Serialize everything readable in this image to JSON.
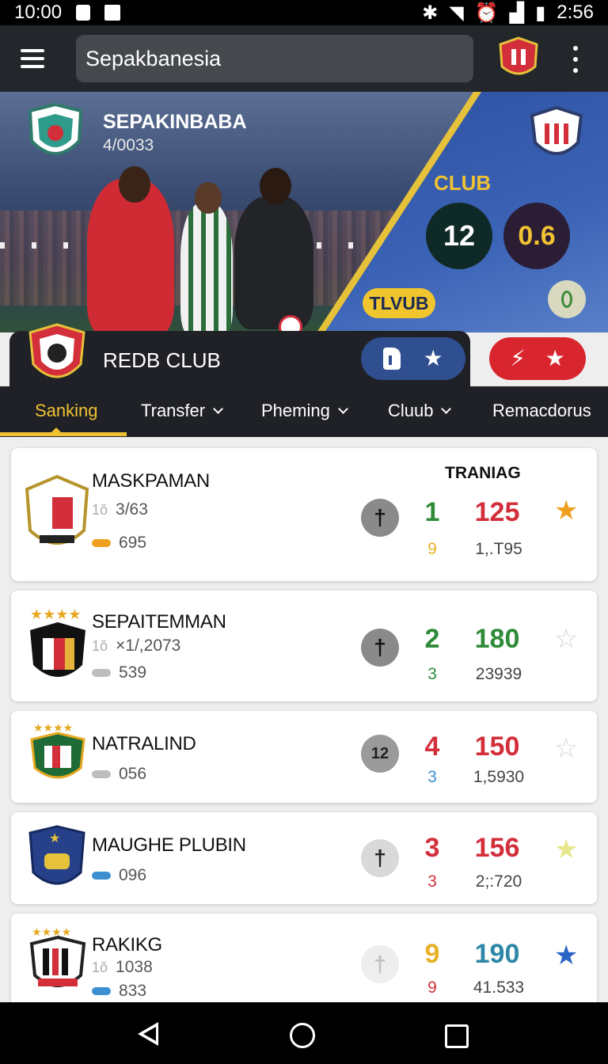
{
  "status_bar": {
    "time_left": "10:00",
    "time_right": "2:56"
  },
  "app_bar": {
    "search_value": "Sepakbanesia"
  },
  "hero": {
    "title": "SEPAKINBABA",
    "subtitle": "4/0033",
    "club_label": "CLUB",
    "score_home": "12",
    "score_away": "0.6",
    "badge": "TLVUB"
  },
  "club_bar": {
    "name": "REDB CLUB"
  },
  "tabs": [
    {
      "label": "Sanking",
      "active": true
    },
    {
      "label": "Transfer"
    },
    {
      "label": "Pheming"
    },
    {
      "label": "Cluub"
    },
    {
      "label": "Remacdorus"
    }
  ],
  "list": {
    "column_header": "TRANIAG",
    "rows": [
      {
        "name": "MASKPAMAN",
        "meta1": "3/63",
        "meta2": "695",
        "cross": "†",
        "rank": "1",
        "rank_color": "#2e8b3a",
        "rank_sub": "9",
        "rank_sub_color": "#e8b12a",
        "points": "125",
        "points_color": "#d22f3b",
        "pts_sub": "1,.T95",
        "star": "★",
        "star_color": "#f0a020"
      },
      {
        "name": "SEPAITEMMAN",
        "meta1": "×1/,2073",
        "meta2": "539",
        "cross": "†",
        "rank": "2",
        "rank_color": "#2e8b3a",
        "rank_sub": "3",
        "rank_sub_color": "#2e8b3a",
        "points": "180",
        "points_color": "#2e8b3a",
        "pts_sub": "23939",
        "star": "☆",
        "star_color": "#d6d6d6"
      },
      {
        "name": "NATRALIND",
        "meta1": "",
        "meta2": "056",
        "cross": "12",
        "rank": "4",
        "rank_color": "#d22f3b",
        "rank_sub": "3",
        "rank_sub_color": "#3c8fd0",
        "points": "150",
        "points_color": "#d22f3b",
        "pts_sub": "1,5930",
        "star": "☆",
        "star_color": "#d6d6d6"
      },
      {
        "name": "MAUGHE PLUBIN",
        "meta1": "",
        "meta2": "096",
        "cross": "†",
        "rank": "3",
        "rank_color": "#d22f3b",
        "rank_sub": "3",
        "rank_sub_color": "#d22f3b",
        "points": "156",
        "points_color": "#d22f3b",
        "pts_sub": "2;:720",
        "star": "★",
        "star_color": "#e7e88e"
      },
      {
        "name": "RAKIKG",
        "meta1": "1038",
        "meta2": "833",
        "cross": "†",
        "rank": "9",
        "rank_color": "#e8b12a",
        "rank_sub": "9",
        "rank_sub_color": "#d22f3b",
        "points": "190",
        "points_color": "#2f87a8",
        "pts_sub": "41.533",
        "star": "★",
        "star_color": "#2a64c5"
      }
    ]
  }
}
